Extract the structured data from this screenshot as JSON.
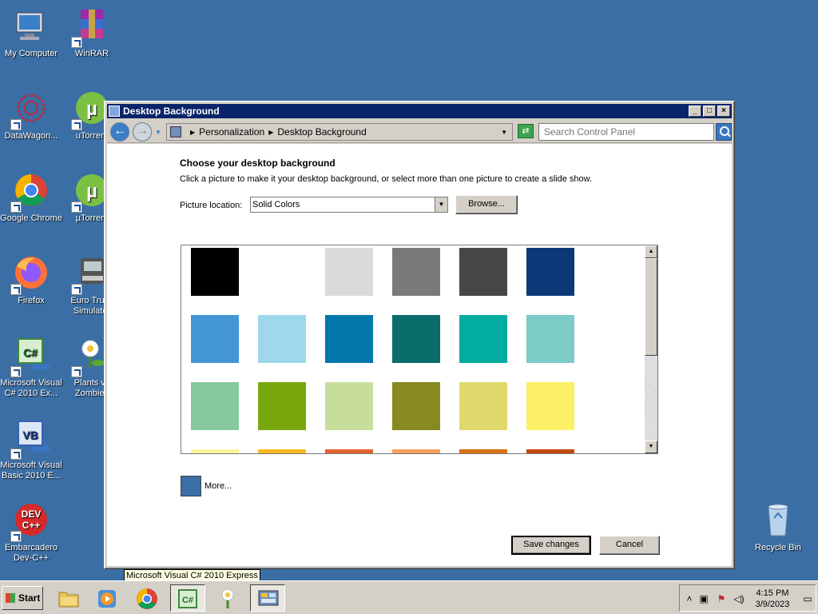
{
  "desktop": {
    "icons": [
      {
        "label": "My Computer"
      },
      {
        "label": "WinRAR"
      },
      {
        "label": "DataWagon..."
      },
      {
        "label": "uTorrent"
      },
      {
        "label": "Google Chrome"
      },
      {
        "label": "µTorrent"
      },
      {
        "label": "Firefox"
      },
      {
        "label": "Euro Truck Simulator"
      },
      {
        "label": "Microsoft Visual C# 2010 Ex..."
      },
      {
        "label": "Plants vs Zombies"
      },
      {
        "label": "Microsoft Visual Basic 2010 E..."
      },
      {
        "label": "Embarcadero Dev-C++"
      },
      {
        "label": "Recycle Bin"
      }
    ]
  },
  "window": {
    "title": "Desktop Background",
    "breadcrumb": [
      "Personalization",
      "Desktop Background"
    ],
    "search_placeholder": "Search Control Panel",
    "heading": "Choose your desktop background",
    "subtext": "Click a picture to make it your desktop background, or select more than one picture to create a slide show.",
    "picture_location_label": "Picture location:",
    "picture_location_value": "Solid Colors",
    "browse_label": "Browse...",
    "more_label": "More...",
    "more_color": "#3a6ea5",
    "save_label": "Save changes",
    "cancel_label": "Cancel",
    "swatches": [
      "#000000",
      "#ffffff",
      "#dadada",
      "#7a7a7a",
      "#474747",
      "#0c3878",
      "#4396d6",
      "#9ed8ea",
      "#0277ab",
      "#0b6c6c",
      "#00ad9f",
      "#7ccbc7",
      "#87c99e",
      "#78a80d",
      "#c6dd9c",
      "#88891e",
      "#dfd96e",
      "#fbf066",
      "#fbf59a",
      "#fbba22",
      "#e2642c",
      "#f7a05c",
      "#db7210",
      "#c4470b"
    ]
  },
  "tooltip": "Microsoft Visual C# 2010 Express",
  "taskbar": {
    "start_label": "Start",
    "items": [
      "file-explorer",
      "media-player",
      "chrome",
      "visual-csharp",
      "plants-vs-zombies",
      "control-panel"
    ],
    "time": "4:15 PM",
    "date": "3/9/2023"
  }
}
